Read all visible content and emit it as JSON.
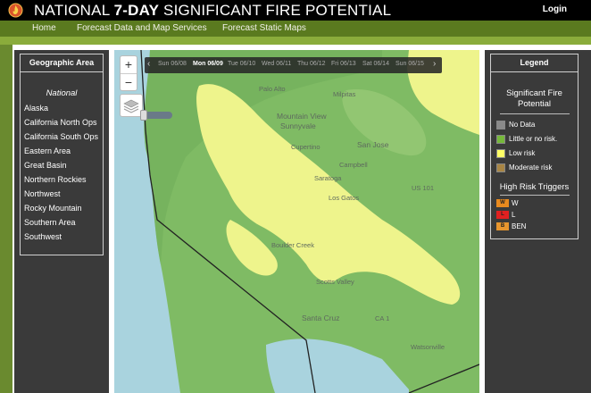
{
  "header": {
    "title_part1": "NATIONAL ",
    "title_bold": "7-DAY",
    "title_part2": " SIGNIFICANT FIRE POTENTIAL",
    "login": "Login"
  },
  "nav": [
    {
      "label": "Home"
    },
    {
      "label": "Forecast Data and Map Services"
    },
    {
      "label": "Forecast Static Maps"
    }
  ],
  "geographic": {
    "heading": "Geographic Area",
    "national": "National",
    "areas": [
      "Alaska",
      "California North Ops",
      "California South Ops",
      "Eastern Area",
      "Great Basin",
      "Northern Rockies",
      "Northwest",
      "Rocky Mountain",
      "Southern Area",
      "Southwest"
    ]
  },
  "timebar": {
    "prev": "‹",
    "next": "›",
    "days": [
      "Sun 06/08",
      "Mon 06/09",
      "Tue 06/10",
      "Wed 06/11",
      "Thu 06/12",
      "Fri 06/13",
      "Sat 06/14",
      "Sun 06/15"
    ],
    "selected": "Mon 06/09"
  },
  "zoom": {
    "in": "+",
    "out": "−"
  },
  "legend": {
    "heading": "Legend",
    "title_line1": "Significant Fire",
    "title_line2": "Potential",
    "items": [
      {
        "label": "No Data",
        "color": "#8a8a8a"
      },
      {
        "label": "Little or no risk.",
        "color": "#76b83a"
      },
      {
        "label": "Low risk",
        "color": "#ffff66"
      },
      {
        "label": "Moderate risk",
        "color": "#a88544"
      }
    ],
    "triggers_title": "High Risk Triggers",
    "triggers": [
      {
        "code": "W",
        "label": "W",
        "color": "#e88a1e"
      },
      {
        "code": "L",
        "label": "L",
        "color": "#e02020"
      },
      {
        "code": "B",
        "label": "BEN",
        "color": "#e8962e"
      }
    ]
  },
  "map": {
    "ocean_color": "#a9d3de",
    "land_color": "#7fbb64",
    "low_risk_color": "#eef48c",
    "labels": [
      "Palo Alto",
      "Milpitas",
      "Mountain View",
      "Sunnyvale",
      "San Jose",
      "Cupertino",
      "Campbell",
      "Saratoga",
      "Los Gatos",
      "US 101",
      "Boulder Creek",
      "Scotts Valley",
      "Santa Cruz",
      "CA 1",
      "Watsonville"
    ]
  }
}
